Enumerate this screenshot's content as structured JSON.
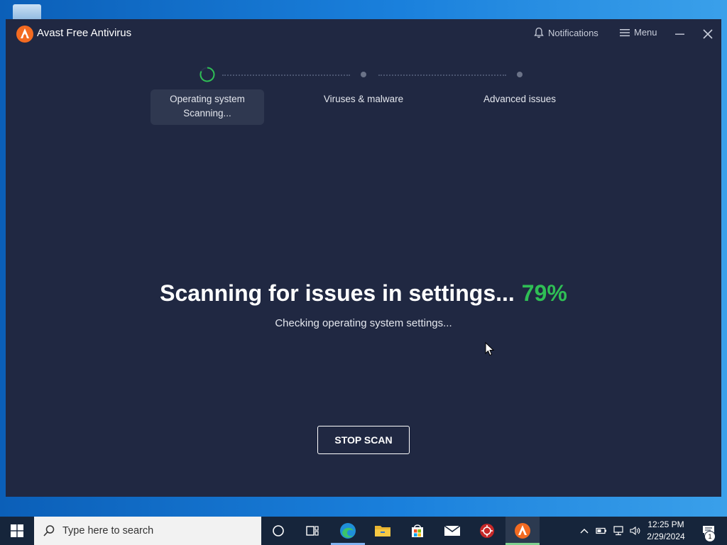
{
  "window": {
    "title": "Avast Free Antivirus",
    "notifications_label": "Notifications",
    "menu_label": "Menu"
  },
  "steps": [
    {
      "label": "Operating system",
      "status": "Scanning..."
    },
    {
      "label": "Viruses & malware"
    },
    {
      "label": "Advanced issues"
    }
  ],
  "scan": {
    "headline": "Scanning for issues in settings...",
    "percent": "79%",
    "subtext": "Checking operating system settings...",
    "stop_label": "STOP SCAN"
  },
  "taskbar": {
    "search_placeholder": "Type here to search",
    "apps": [
      "cortana-icon",
      "task-view-icon",
      "edge-icon",
      "file-explorer-icon",
      "store-icon",
      "mail-icon",
      "antivirus-icon",
      "avast-icon"
    ],
    "clock_time": "12:25 PM",
    "clock_date": "2/29/2024",
    "notification_count": "1"
  },
  "colors": {
    "window_bg": "#202842",
    "accent_green": "#2fbf55",
    "avast_orange": "#f36b21"
  }
}
